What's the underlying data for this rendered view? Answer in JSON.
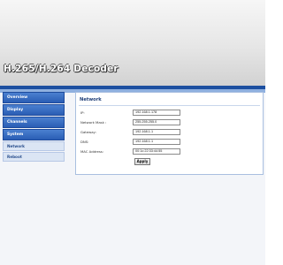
{
  "header": {
    "title": "H.265/H.264 Decoder"
  },
  "sidebar": {
    "items": [
      {
        "label": "Overview"
      },
      {
        "label": "Display"
      },
      {
        "label": "Channels"
      },
      {
        "label": "System"
      }
    ],
    "sub_items": [
      {
        "label": "Network"
      },
      {
        "label": "Reboot"
      }
    ]
  },
  "panel": {
    "title": "Network",
    "fields": [
      {
        "label": "IP:",
        "value": "192.168.1.178"
      },
      {
        "label": "Network Mask :",
        "value": "255.255.255.0"
      },
      {
        "label": "Gateway:",
        "value": "192.168.1.1"
      },
      {
        "label": "DNS:",
        "value": "192.168.1.1"
      },
      {
        "label": "MAC Address:",
        "value": "00:1c:22:33:44:55"
      }
    ],
    "apply_label": "Apply"
  }
}
